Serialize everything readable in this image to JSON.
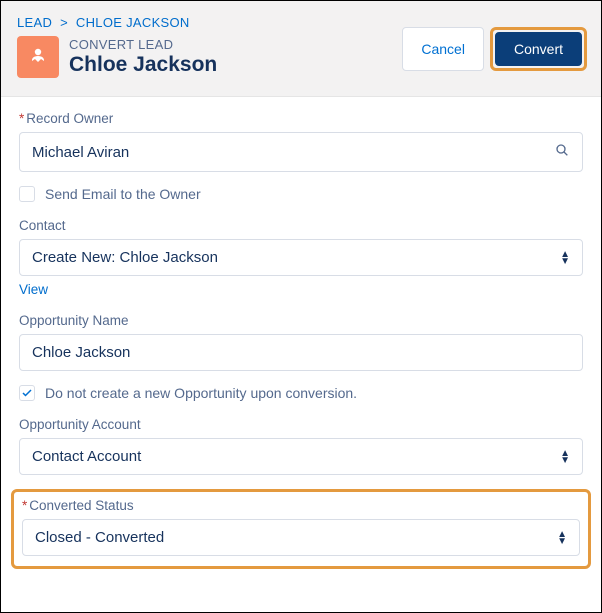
{
  "breadcrumb": {
    "root": "LEAD",
    "current": "CHLOE JACKSON"
  },
  "header": {
    "eyebrow": "CONVERT LEAD",
    "name": "Chloe Jackson",
    "cancel_label": "Cancel",
    "convert_label": "Convert"
  },
  "fields": {
    "record_owner": {
      "label": "Record Owner",
      "value": "Michael Aviran"
    },
    "send_email": {
      "label": "Send Email to the Owner",
      "checked": false
    },
    "contact": {
      "label": "Contact",
      "value": "Create New: Chloe Jackson",
      "view_label": "View"
    },
    "opp_name": {
      "label": "Opportunity Name",
      "value": "Chloe Jackson"
    },
    "no_opp": {
      "label": "Do not create a new Opportunity upon conversion.",
      "checked": true
    },
    "opp_account": {
      "label": "Opportunity Account",
      "value": "Contact Account"
    },
    "converted_status": {
      "label": "Converted Status",
      "value": "Closed - Converted"
    }
  }
}
